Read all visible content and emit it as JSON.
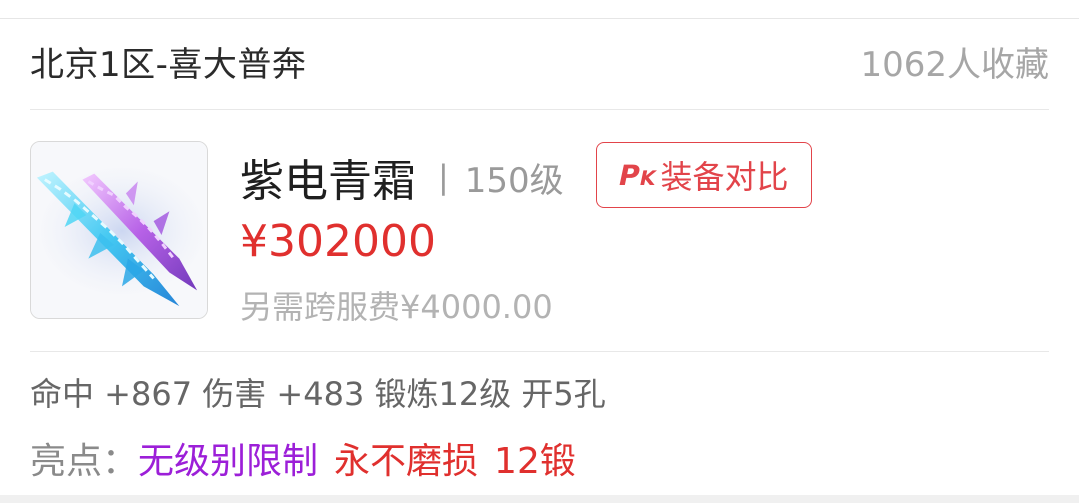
{
  "header": {
    "server": "北京1区-喜大普奔",
    "favorites": "1062人收藏"
  },
  "item": {
    "name": "紫电青霜",
    "separator": "|",
    "level": "150级",
    "price": "¥302000",
    "extra_fee": "另需跨服费¥4000.00",
    "image_icon": "purple-blue-crystal-blades-icon"
  },
  "compare_button": {
    "badge_p": "P",
    "badge_k": "K",
    "label": "装备对比",
    "color": "#e2444a"
  },
  "attributes": "命中 +867 伤害 +483 锻炼12级 开5孔",
  "highlights": {
    "label": "亮点：",
    "tags": [
      {
        "text": "无级别限制",
        "color": "#9c1fd8"
      },
      {
        "text": "永不磨损",
        "color": "#e0302e"
      },
      {
        "text": "12锻",
        "color": "#e0302e"
      }
    ]
  }
}
